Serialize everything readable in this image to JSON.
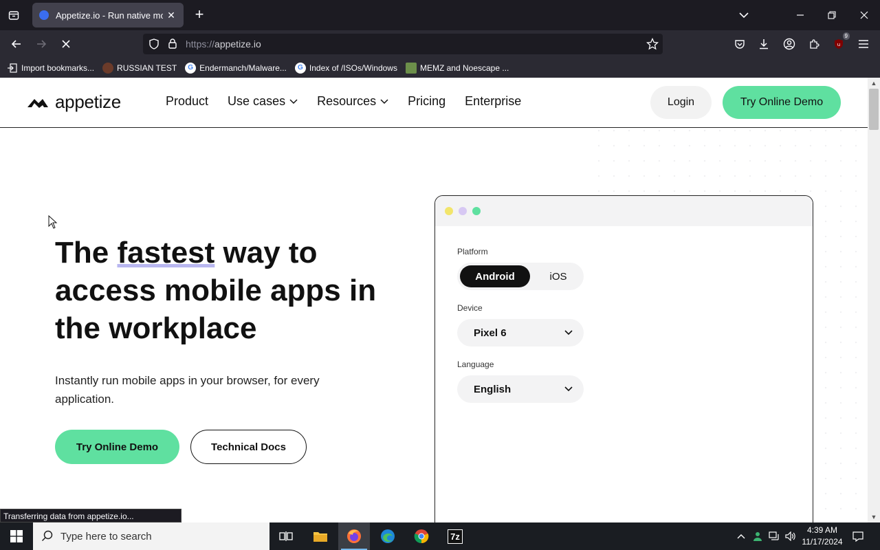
{
  "browser": {
    "tab_title": "Appetize.io - Run native mobile apps in your browser",
    "tab_close": "✕",
    "new_tab": "+",
    "url_protocol": "https://",
    "url_host": "appetize.io",
    "extension_badge": "9",
    "bookmarks": [
      {
        "label": "Import bookmarks...",
        "icon": "import-icon"
      },
      {
        "label": "RUSSIAN TEST",
        "icon": "circle-icon"
      },
      {
        "label": "Endermanch/Malware...",
        "icon": "google-icon"
      },
      {
        "label": "Index of /ISOs/Windows",
        "icon": "google-icon"
      },
      {
        "label": "MEMZ and Noescape ...",
        "icon": "image-icon"
      }
    ],
    "status_text": "Transferring data from appetize.io..."
  },
  "site": {
    "logo_text": "appetize",
    "nav": [
      {
        "label": "Product",
        "has_dropdown": false
      },
      {
        "label": "Use cases",
        "has_dropdown": true
      },
      {
        "label": "Resources",
        "has_dropdown": true
      },
      {
        "label": "Pricing",
        "has_dropdown": false
      },
      {
        "label": "Enterprise",
        "has_dropdown": false
      }
    ],
    "login_label": "Login",
    "demo_label": "Try Online Demo",
    "brand_green": "#5fe0a0"
  },
  "hero": {
    "title_part1": "The ",
    "title_highlight": "fastest",
    "title_part2": " way to access mobile apps in the workplace",
    "subtitle": "Instantly run mobile apps in your browser, for every application.",
    "primary_button": "Try Online Demo",
    "secondary_button": "Technical Docs"
  },
  "demo": {
    "platform_label": "Platform",
    "platform_options": [
      "Android",
      "iOS"
    ],
    "platform_selected": "Android",
    "device_label": "Device",
    "device_value": "Pixel 6",
    "language_label": "Language",
    "language_value": "English",
    "traffic_light_colors": [
      "#f2e56b",
      "#d7c8f3",
      "#5fe0a0"
    ]
  },
  "taskbar": {
    "search_placeholder": "Type here to search",
    "apps": [
      "task-view-icon",
      "file-explorer-icon",
      "firefox-icon",
      "edge-icon",
      "chrome-icon",
      "7zip-icon"
    ],
    "zip_label": "7z",
    "time": "4:39 AM",
    "date": "11/17/2024"
  }
}
